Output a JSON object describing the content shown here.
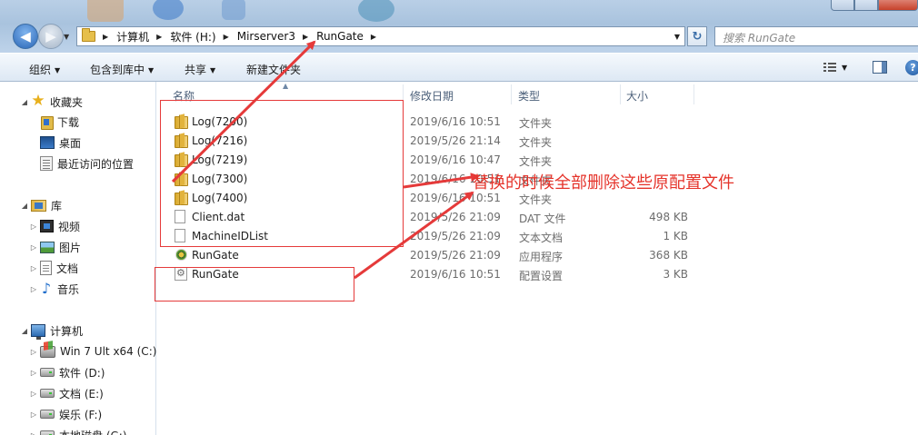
{
  "window": {
    "controls": {
      "minimize": "–",
      "maximize": "□",
      "close": "✕"
    }
  },
  "navigation": {
    "back_symbol": "◀",
    "forward_symbol": "▶",
    "dropdown_symbol": "▼"
  },
  "address_bar": {
    "breadcrumbs": [
      "计算机",
      "软件 (H:)",
      "Mirserver3",
      "RunGate"
    ],
    "separator": "▶",
    "dropdown_symbol": "▼",
    "refresh_symbol": "↻"
  },
  "search": {
    "placeholder": "搜索 RunGate"
  },
  "command_bar": {
    "organize": "组织",
    "include_in_library": "包含到库中",
    "share": "共享",
    "new_folder": "新建文件夹",
    "dropdown_symbol": "▼",
    "help_symbol": "?"
  },
  "nav_pane": {
    "favorites": {
      "label": "收藏夹",
      "items": [
        "下载",
        "桌面",
        "最近访问的位置"
      ]
    },
    "libraries": {
      "label": "库",
      "items": [
        "视频",
        "图片",
        "文档",
        "音乐"
      ]
    },
    "computer": {
      "label": "计算机",
      "items": [
        "Win 7 Ult x64 (C:)",
        "软件 (D:)",
        "文档 (E:)",
        "娱乐 (F:)",
        "本地磁盘 (G:)"
      ]
    },
    "expanded_symbol": "◢",
    "collapsed_symbol": "▷"
  },
  "columns": {
    "name": "名称",
    "date": "修改日期",
    "type": "类型",
    "size": "大小",
    "sort_symbol": "▲"
  },
  "files": [
    {
      "name": "Log(7200)",
      "date": "2019/6/16 10:51",
      "type": "文件夹",
      "size": "",
      "icon": "folder-icon"
    },
    {
      "name": "Log(7216)",
      "date": "2019/5/26 21:14",
      "type": "文件夹",
      "size": "",
      "icon": "folder-icon"
    },
    {
      "name": "Log(7219)",
      "date": "2019/6/16 10:47",
      "type": "文件夹",
      "size": "",
      "icon": "folder-icon"
    },
    {
      "name": "Log(7300)",
      "date": "2019/6/16 10:51",
      "type": "文件夹",
      "size": "",
      "icon": "folder-icon"
    },
    {
      "name": "Log(7400)",
      "date": "2019/6/16 10:51",
      "type": "文件夹",
      "size": "",
      "icon": "folder-icon"
    },
    {
      "name": "Client.dat",
      "date": "2019/5/26 21:09",
      "type": "DAT 文件",
      "size": "498 KB",
      "icon": "file-icon"
    },
    {
      "name": "MachineIDList",
      "date": "2019/5/26 21:09",
      "type": "文本文档",
      "size": "1 KB",
      "icon": "text-file-icon"
    },
    {
      "name": "RunGate",
      "date": "2019/5/26 21:09",
      "type": "应用程序",
      "size": "368 KB",
      "icon": "exe-icon"
    },
    {
      "name": "RunGate",
      "date": "2019/6/16 10:51",
      "type": "配置设置",
      "size": "3 KB",
      "icon": "ini-icon"
    }
  ],
  "annotation": {
    "text": "替换的时候全部删除这些原配置文件",
    "color": "#e5332a"
  }
}
